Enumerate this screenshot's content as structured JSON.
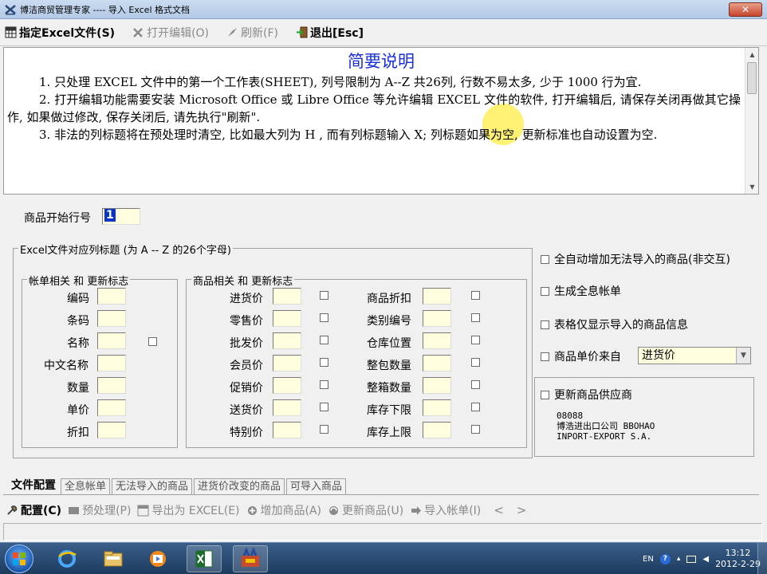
{
  "window": {
    "title": "博洁商贸管理专家 ---- 导入 Excel 格式文档",
    "close_glyph": "✕"
  },
  "toolbar": {
    "items": [
      {
        "label": "指定Excel文件(S)",
        "icon": "spreadsheet-icon",
        "enabled": true
      },
      {
        "label": "打开编辑(O)",
        "icon": "tools-icon",
        "enabled": false
      },
      {
        "label": "刷新(F)",
        "icon": "refresh-icon",
        "enabled": false
      },
      {
        "label": "退出[Esc]",
        "icon": "exit-icon",
        "enabled": true
      }
    ]
  },
  "memo": {
    "title": "简要说明",
    "paragraphs": [
      "1.  只处理 EXCEL 文件中的第一个工作表(SHEET), 列号限制为 A--Z 共26列, 行数不易太多, 少于 1000 行为宜.",
      "2.  打开编辑功能需要安装 Microsoft Office 或 Libre Office 等允许编辑 EXCEL 文件的软件, 打开编辑后, 请保存关闭再做其它操作, 如果做过修改, 保存关闭后, 请先执行\"刷新\".",
      "3.  非法的列标题将在预处理时清空, 比如最大列为 H , 而有列标题输入 X; 列标题如果为空, 更新标准也自动设置为空."
    ]
  },
  "form": {
    "start_row_label": "商品开始行号",
    "start_row_value": "1",
    "excel_group_label": "Excel文件对应列标题 (为 A -- Z 的26个字母)",
    "account_group_label": "帐单相关  和  更新标志",
    "product_group_label": "商品相关  和  更新标志",
    "account_fields": [
      "编码",
      "条码",
      "名称",
      "中文名称",
      "数量",
      "单价",
      "折扣"
    ],
    "product_fields_col1": [
      "进货价",
      "零售价",
      "批发价",
      "会员价",
      "促销价",
      "送货价",
      "特别价"
    ],
    "product_fields_col2": [
      "商品折扣",
      "类别编号",
      "仓库位置",
      "整包数量",
      "整箱数量",
      "库存下限",
      "库存上限"
    ]
  },
  "options": {
    "auto_add": "全自动增加无法导入的商品(非交互)",
    "gen_full_bill": "生成全息帐单",
    "grid_only_import": "表格仅显示导入的商品信息",
    "price_source_label": "商品单价来自",
    "price_source_value": "进货价",
    "update_supplier": "更新商品供应商",
    "supplier_lines": [
      "08088",
      "博浩进出口公司 BBOHAO",
      "INPORT-EXPORT S.A."
    ]
  },
  "tabs": [
    "文件配置",
    "全息帐单",
    "无法导入的商品",
    "进货价改变的商品",
    "可导入商品"
  ],
  "bottom_toolbar": {
    "items": [
      {
        "label": "配置(C)",
        "icon": "config-icon",
        "enabled": true
      },
      {
        "label": "预处理(P)",
        "icon": "preprocess-icon",
        "enabled": false
      },
      {
        "label": "导出为 EXCEL(E)",
        "icon": "export-icon",
        "enabled": false
      },
      {
        "label": "增加商品(A)",
        "icon": "add-product-icon",
        "enabled": false
      },
      {
        "label": "更新商品(U)",
        "icon": "update-product-icon",
        "enabled": false
      },
      {
        "label": "导入帐单(I)",
        "icon": "import-bill-icon",
        "enabled": false
      }
    ],
    "prev": "<",
    "next": ">"
  },
  "taskbar": {
    "lang": "EN",
    "time": "13:12",
    "date": "2012-2-29"
  },
  "colors": {
    "memo_title": "#1a2fd8",
    "input_bg": "#ffffe0",
    "selection": "#0a36c8"
  }
}
